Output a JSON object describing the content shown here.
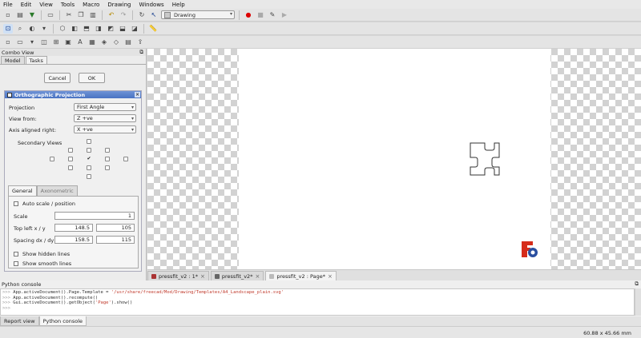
{
  "menu": [
    "File",
    "Edit",
    "View",
    "Tools",
    "Macro",
    "Drawing",
    "Windows",
    "Help"
  ],
  "workbench": {
    "selected": "Drawing"
  },
  "combo_view": {
    "title": "Combo View",
    "tabs": [
      "Model",
      "Tasks"
    ],
    "cancel_label": "Cancel",
    "ok_label": "OK"
  },
  "ortho": {
    "title": "Orthographic Projection",
    "projection_label": "Projection",
    "projection_value": "First Angle",
    "view_from_label": "View from:",
    "view_from_value": "Z +ve",
    "axis_label": "Axis aligned right:",
    "axis_value": "X +ve",
    "secondary_label": "Secondary Views",
    "tabs": [
      "General",
      "Axonometric"
    ],
    "auto_scale_label": "Auto scale / position",
    "scale_label": "Scale",
    "scale_value": "1",
    "top_left_label": "Top left x / y",
    "top_left_x": "148.5",
    "top_left_y": "105",
    "spacing_label": "Spacing dx / dy",
    "spacing_dx": "158.5",
    "spacing_dy": "115",
    "hidden_label": "Show hidden lines",
    "smooth_label": "Show smooth lines"
  },
  "doc_tabs": [
    {
      "label": "pressfit_v2 : 1*"
    },
    {
      "label": "pressfit_v2*"
    },
    {
      "label": "pressfit_v2 : Page*"
    }
  ],
  "python_console": {
    "title": "Python console",
    "lines": [
      {
        "prompt": ">>> ",
        "code": "App.activeDocument().Page.Template = ",
        "str": "'/usr/share/freecad/Mod/Drawing/Templates/A4_Landscape_plain.svg'"
      },
      {
        "prompt": ">>> ",
        "code": "App.activeDocument().recompute()",
        "str": ""
      },
      {
        "prompt": ">>> ",
        "code": "Gui.activeDocument().getObject(",
        "str": "'Page'",
        "tail": ").show()"
      },
      {
        "prompt": ">>> ",
        "code": "",
        "str": ""
      }
    ]
  },
  "bottom_tabs": [
    "Report view",
    "Python console"
  ],
  "status": {
    "dimensions": "60.88 x 45.66 mm"
  },
  "colors": {
    "accent": "#4a73c2",
    "checker": "#d2d2d2",
    "logo_red": "#d62c1a",
    "logo_blue": "#2a4fa0"
  }
}
